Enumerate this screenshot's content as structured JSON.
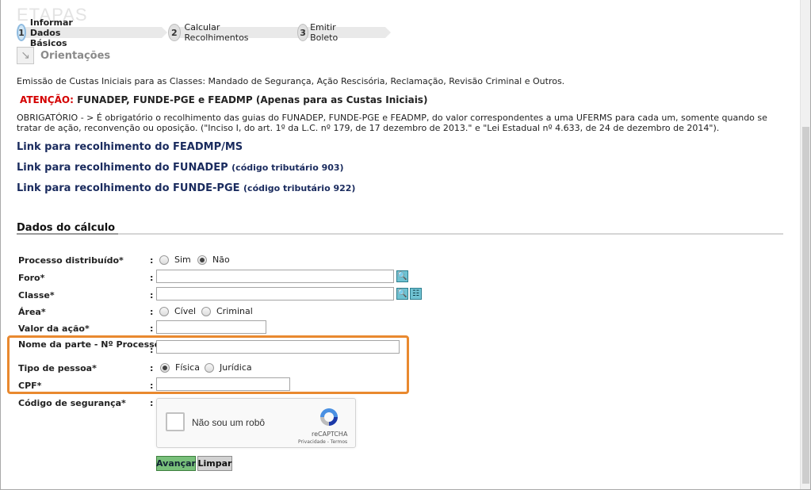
{
  "etapas_label": "ETAPAS",
  "steps": [
    {
      "num": "1",
      "label": "Informar Dados Básicos",
      "active": true
    },
    {
      "num": "2",
      "label": "Calcular Recolhimentos",
      "active": false
    },
    {
      "num": "3",
      "label": "Emitir Boleto",
      "active": false
    }
  ],
  "orientacoes_label": "Orientações",
  "intro_text": "Emissão de Custas Iniciais para as Classes: Mandado de Segurança, Ação Rescisória, Reclamação, Revisão Criminal e Outros.",
  "atencao_label": "ATENÇÃO:",
  "atencao_text": "FUNADEP, FUNDE-PGE e FEADMP (Apenas para as Custas Iniciais)",
  "obrigatorio_text": "OBRIGATÓRIO - > É obrigatório o recolhimento das guias do FUNADEP, FUNDE-PGE e FEADMP, do valor correspondentes a uma UFERMS para cada um, somente quando se tratar de ação, reconvenção ou oposição. (\"Inciso I, do art. 1º da L.C. nº 179, de 17 dezembro de 2013.\" e \"Lei Estadual nº 4.633, de 24 de dezembro de 2014\").",
  "links": [
    {
      "text": "Link para recolhimento do FEADMP/MS",
      "code": ""
    },
    {
      "text": "Link para recolhimento do FUNADEP",
      "code": "(código tributário 903)"
    },
    {
      "text": "Link para recolhimento do FUNDE-PGE",
      "code": "(código tributário 922)"
    }
  ],
  "section_title": "Dados do cálculo",
  "form": {
    "colon": ":",
    "processo_label": "Processo distribuído*",
    "processo_opts": [
      "Sim",
      "Não"
    ],
    "processo_selected": "Não",
    "foro_label": "Foro*",
    "foro_value": "",
    "classe_label": "Classe*",
    "classe_value": "",
    "area_label": "Área*",
    "area_opts": [
      "Cível",
      "Criminal"
    ],
    "area_selected": "",
    "valor_label": "Valor da ação*",
    "valor_value": "",
    "nome_label": "Nome da parte - Nº Processo*",
    "nome_value": "",
    "tipo_label": "Tipo de pessoa*",
    "tipo_opts": [
      "Física",
      "Jurídica"
    ],
    "tipo_selected": "Física",
    "cpf_label": "CPF*",
    "cpf_value": "",
    "codigo_label": "Código de segurança*"
  },
  "captcha": {
    "text": "Não sou um robô",
    "brand": "reCAPTCHA",
    "terms": "Privacidade - Termos"
  },
  "buttons": {
    "avancar": "Avançar",
    "limpar": "Limpar"
  },
  "colors": {
    "highlight": "#e9892f",
    "attention": "#d40000",
    "link": "#1a2b5e",
    "avancar_bg": "#79c07b"
  }
}
